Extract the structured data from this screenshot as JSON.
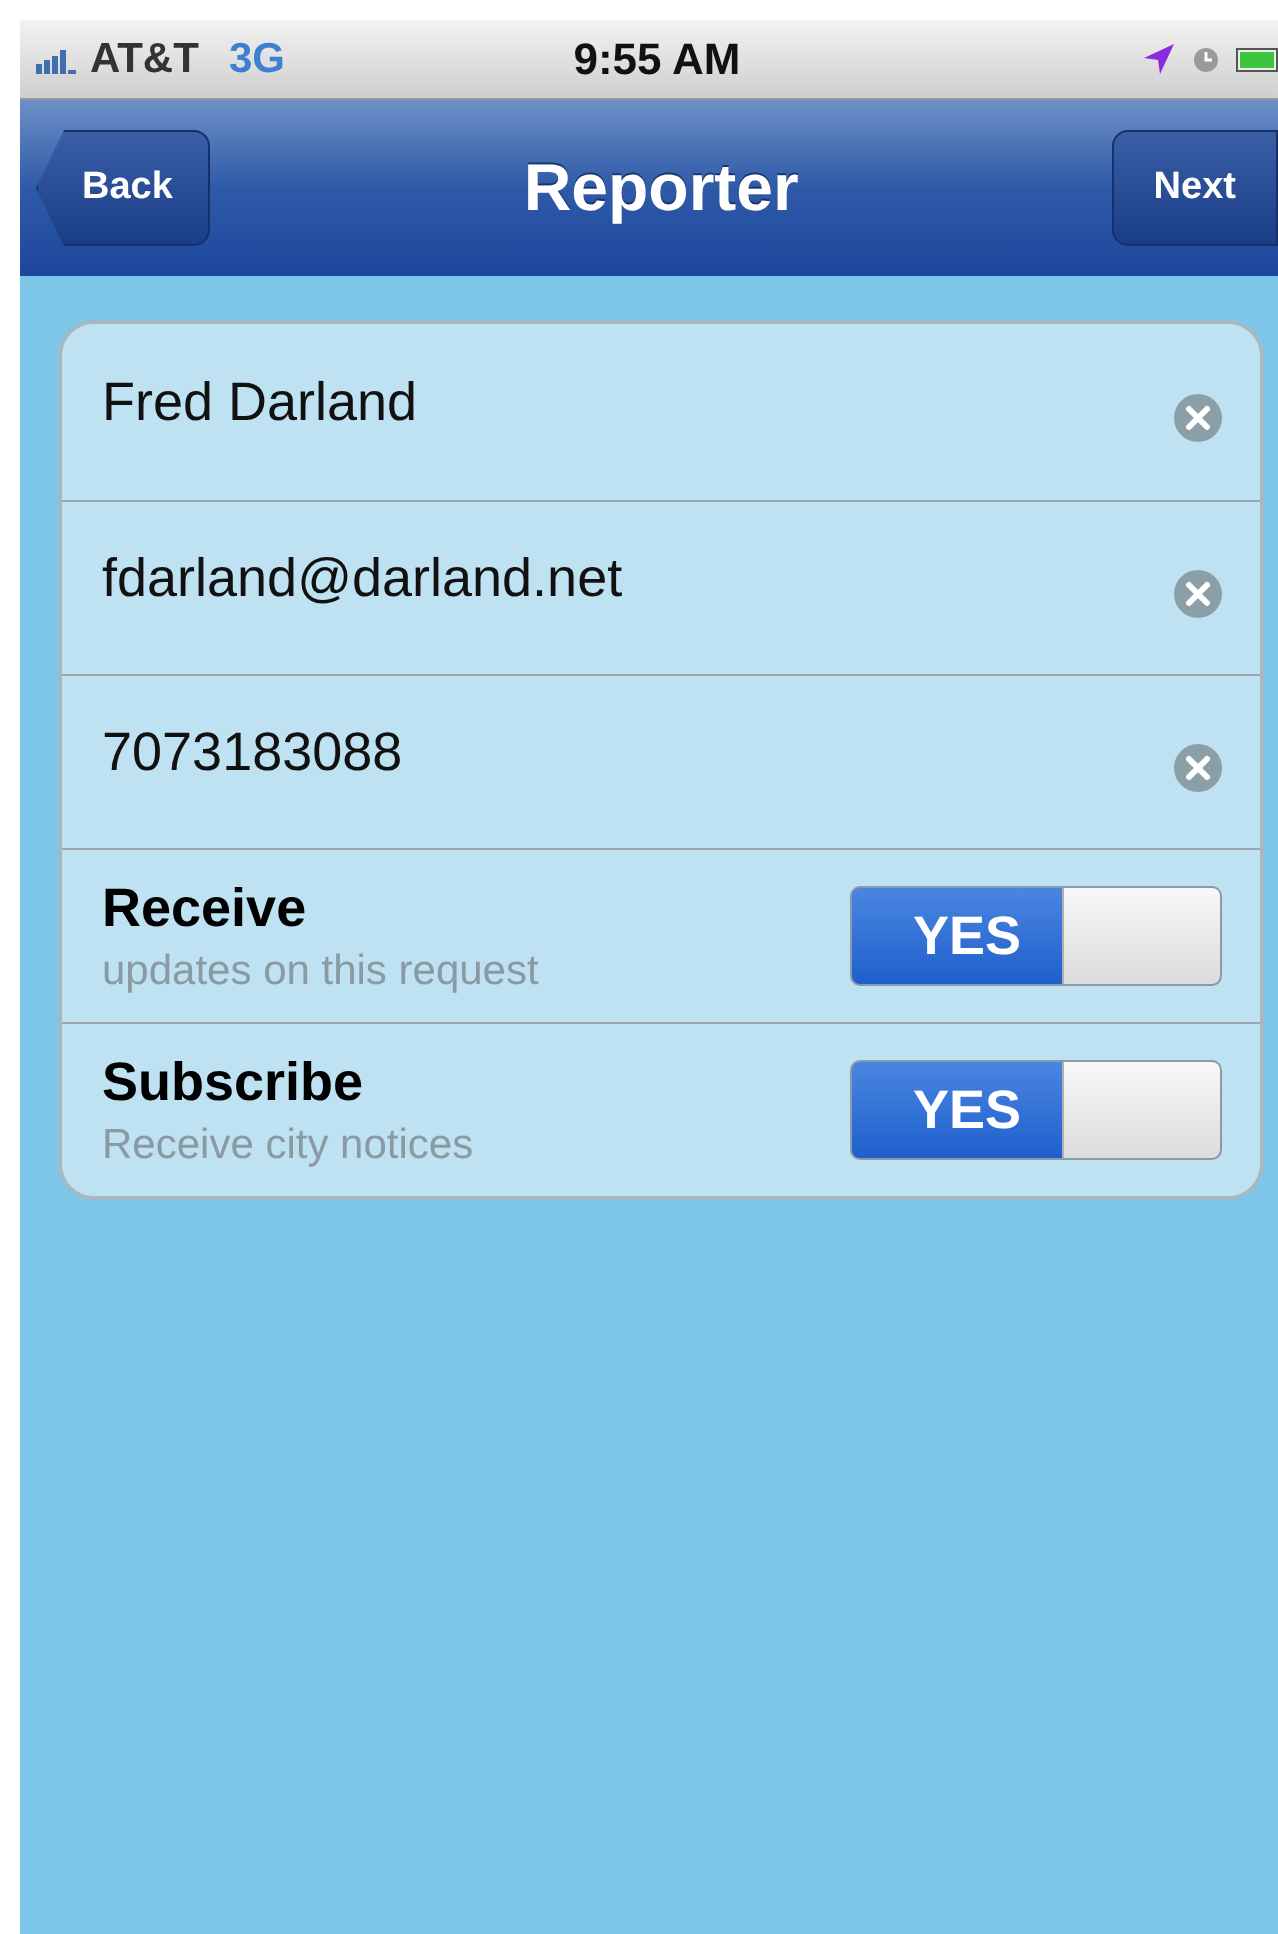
{
  "status_bar": {
    "carrier": "AT&T",
    "network": "3G",
    "time": "9:55 AM"
  },
  "nav_bar": {
    "back": "Back",
    "title": "Reporter",
    "next": "Next"
  },
  "form": {
    "fields": [
      {
        "kind": "text",
        "value": "Fred Darland"
      },
      {
        "kind": "text",
        "value": "fdarland@darland.net"
      },
      {
        "kind": "text",
        "value": "7073183088"
      },
      {
        "kind": "toggle",
        "label": "Receive",
        "detail": "updates on this request",
        "on": true,
        "on_text": "YES"
      },
      {
        "kind": "toggle",
        "label": "Subscribe",
        "detail": "Receive city notices",
        "on": true,
        "on_text": "YES"
      }
    ]
  }
}
